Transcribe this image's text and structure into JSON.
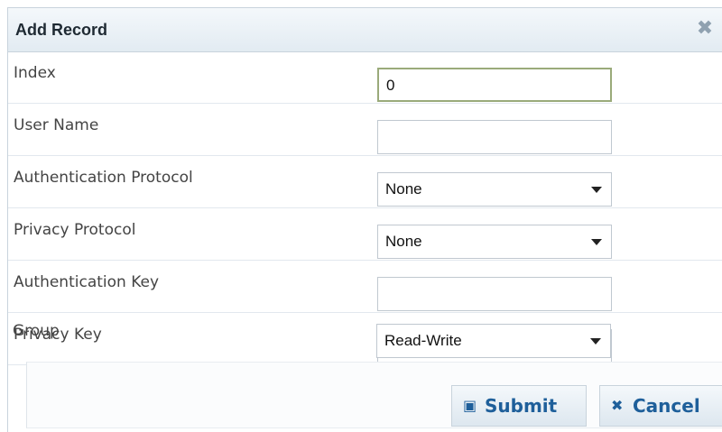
{
  "dialog": {
    "title": "Add Record",
    "close_icon": "close-icon"
  },
  "fields": [
    {
      "label": "Index",
      "type": "text",
      "value": "0",
      "active": true
    },
    {
      "label": "User Name",
      "type": "text",
      "value": ""
    },
    {
      "label": "Authentication Protocol",
      "type": "select",
      "value": "None"
    },
    {
      "label": "Privacy Protocol",
      "type": "select",
      "value": "None"
    },
    {
      "label": "Authentication Key",
      "type": "text",
      "value": ""
    },
    {
      "label": "Privacy Key",
      "type": "text",
      "value": ""
    },
    {
      "label": "Group",
      "type": "select",
      "value": "Read-Write"
    }
  ],
  "buttons": {
    "submit_label": "Submit",
    "cancel_label": "Cancel"
  },
  "colors": {
    "accent": "#1e5f9a",
    "border": "#c8d3dc"
  }
}
